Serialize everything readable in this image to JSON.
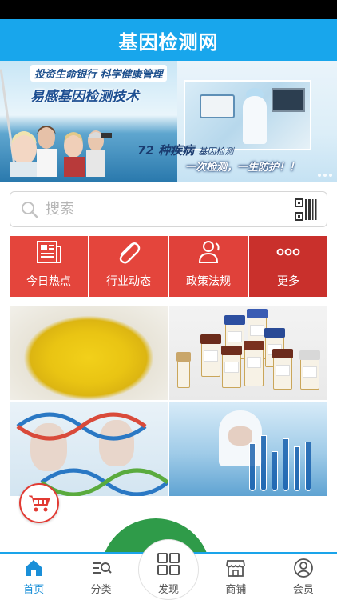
{
  "app": {
    "title": "基因检测网"
  },
  "banner": {
    "tagline": "投资生命银行 科学健康管理",
    "headline": "易感基因检测技术",
    "promo_line_1": "72 种疾病",
    "promo_line_1_sub": "基因检测",
    "promo_line_2": "一次检测，一生防护！！"
  },
  "search": {
    "placeholder": "搜索"
  },
  "categories": [
    {
      "label": "今日热点",
      "icon": "newspaper-icon"
    },
    {
      "label": "行业动态",
      "icon": "paperclip-icon"
    },
    {
      "label": "政策法规",
      "icon": "people-icon"
    },
    {
      "label": "更多",
      "icon": "more-icon"
    }
  ],
  "bottom_nav": {
    "home": "首页",
    "category": "分类",
    "discover": "发现",
    "shop": "商铺",
    "member": "会员"
  },
  "colors": {
    "primary": "#18a6ec",
    "tile_red": "#e4453c",
    "tile_dark_red": "#c9302c",
    "active_nav": "#1a8fd8"
  }
}
